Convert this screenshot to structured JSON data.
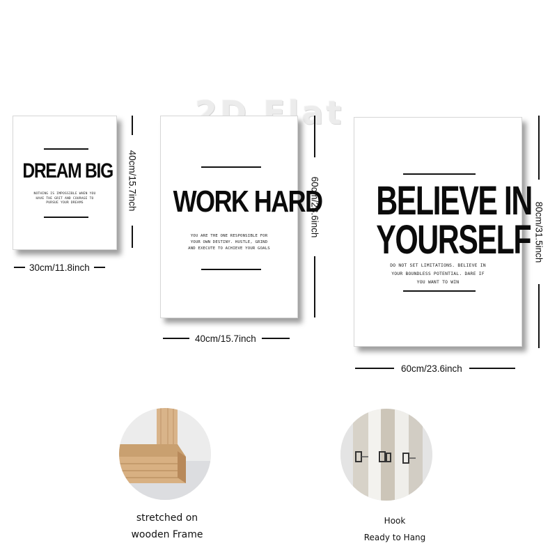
{
  "watermark": "2D Flat",
  "canvases": [
    {
      "headline": "DREAM BIG",
      "body": [
        "NOTHING IS IMPOSSIBLE WHEN YOU",
        "HAVE THE GRIT AND COURAGE TO",
        "PURSUE YOUR DREAMS"
      ],
      "width_label": "30cm/11.8inch",
      "height_label": "40cm/15.7inch"
    },
    {
      "headline": "WORK HARD",
      "body": [
        "YOU ARE THE ONE RESPONSIBLE FOR",
        "YOUR OWN DESTINY. HUSTLE, GRIND",
        "AND EXECUTE TO ACHIEVE YOUR GOALS"
      ],
      "width_label": "40cm/15.7inch",
      "height_label": "60cm/23.6inch"
    },
    {
      "headline_line1": "BELIEVE IN",
      "headline_line2": "YOURSELF",
      "body": [
        "DO NOT SET LIMITATIONS. BELIEVE IN",
        "YOUR BOUNDLESS POTENTIAL. DARE IF",
        "YOU WANT TO WIN"
      ],
      "width_label": "60cm/23.6inch",
      "height_label": "80cm/31.5inch"
    }
  ],
  "features": [
    {
      "icon": "wooden-frame-icon",
      "caption_line1": "stretched on",
      "caption_line2": "wooden Frame"
    },
    {
      "icon": "hook-icon",
      "caption_line1": "Hook",
      "caption_line2": "Ready to Hang"
    }
  ],
  "colors": {
    "text": "#111111",
    "background": "#ffffff",
    "wood": "#d9b48a"
  }
}
